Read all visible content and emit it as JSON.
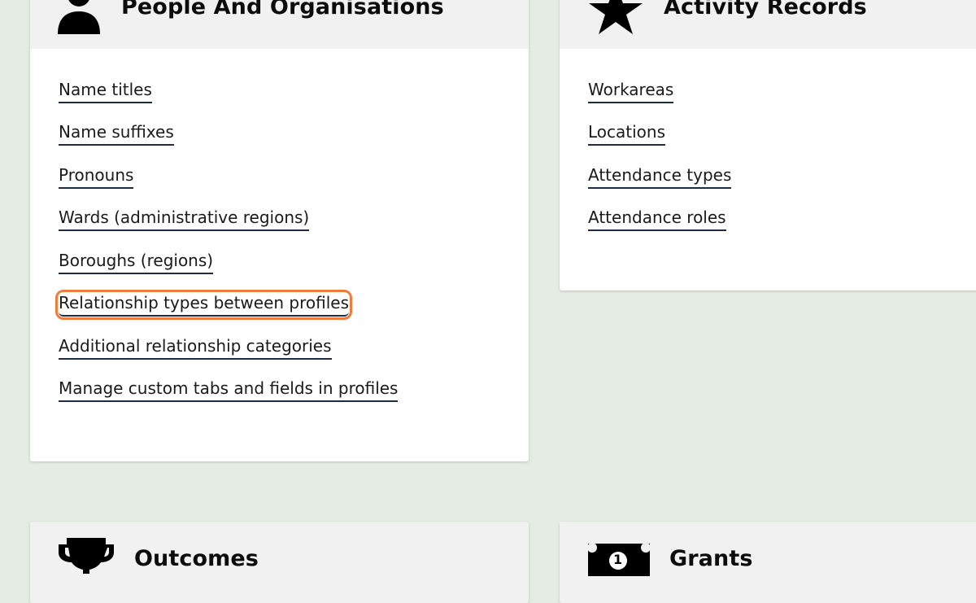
{
  "people_card": {
    "title": "People And Organisations",
    "icon": "person-icon",
    "links": [
      "Name titles",
      "Name suffixes",
      "Pronouns",
      "Wards (administrative regions)",
      "Boroughs (regions)",
      "Relationship types between profiles",
      "Additional relationship categories",
      "Manage custom tabs and fields in profiles"
    ],
    "highlighted_link": "Relationship types between profiles"
  },
  "activity_card": {
    "title": "Activity Records",
    "icon": "star-icon",
    "links": [
      "Workareas",
      "Locations",
      "Attendance types",
      "Attendance roles"
    ]
  },
  "outcomes_card": {
    "title": "Outcomes",
    "icon": "trophy-icon"
  },
  "grants_card": {
    "title": "Grants",
    "icon": "banknote-icon",
    "icon_text": "1"
  },
  "colors": {
    "page_background": "#e4ece3",
    "card_header": "#f1f1f1",
    "highlight": "#f07c3c",
    "link_underline": "#1f2a44"
  }
}
